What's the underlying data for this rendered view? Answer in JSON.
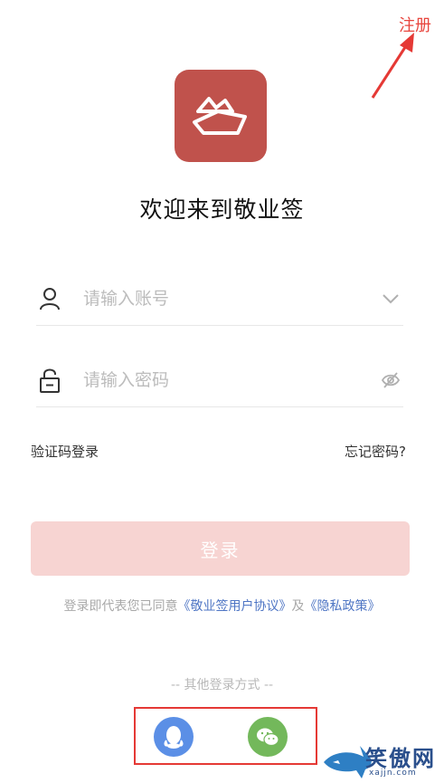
{
  "header": {
    "register_label": "注册"
  },
  "welcome_title": "欢迎来到敬业签",
  "form": {
    "account_placeholder": "请输入账号",
    "password_placeholder": "请输入密码"
  },
  "links": {
    "sms_login": "验证码登录",
    "forgot_password": "忘记密码?"
  },
  "login_button_label": "登录",
  "agreement": {
    "prefix": "登录即代表您已同意",
    "user_agreement": "《敬业签用户协议》",
    "conjunction": "及",
    "privacy_policy": "《隐私政策》"
  },
  "other_login_label": "-- 其他登录方式 --",
  "social_buttons": [
    "qq-icon",
    "wechat-icon"
  ],
  "watermark": {
    "text": "笑傲网",
    "sub": "xajjn.com"
  },
  "colors": {
    "brand": "#c0524c",
    "login_button_disabled": "#f7d4d2",
    "register": "#e8463e",
    "link_blue": "#4e75c4",
    "qq": "#5b8fe6",
    "wechat": "#73b85b",
    "annotation_red": "#e53935"
  }
}
